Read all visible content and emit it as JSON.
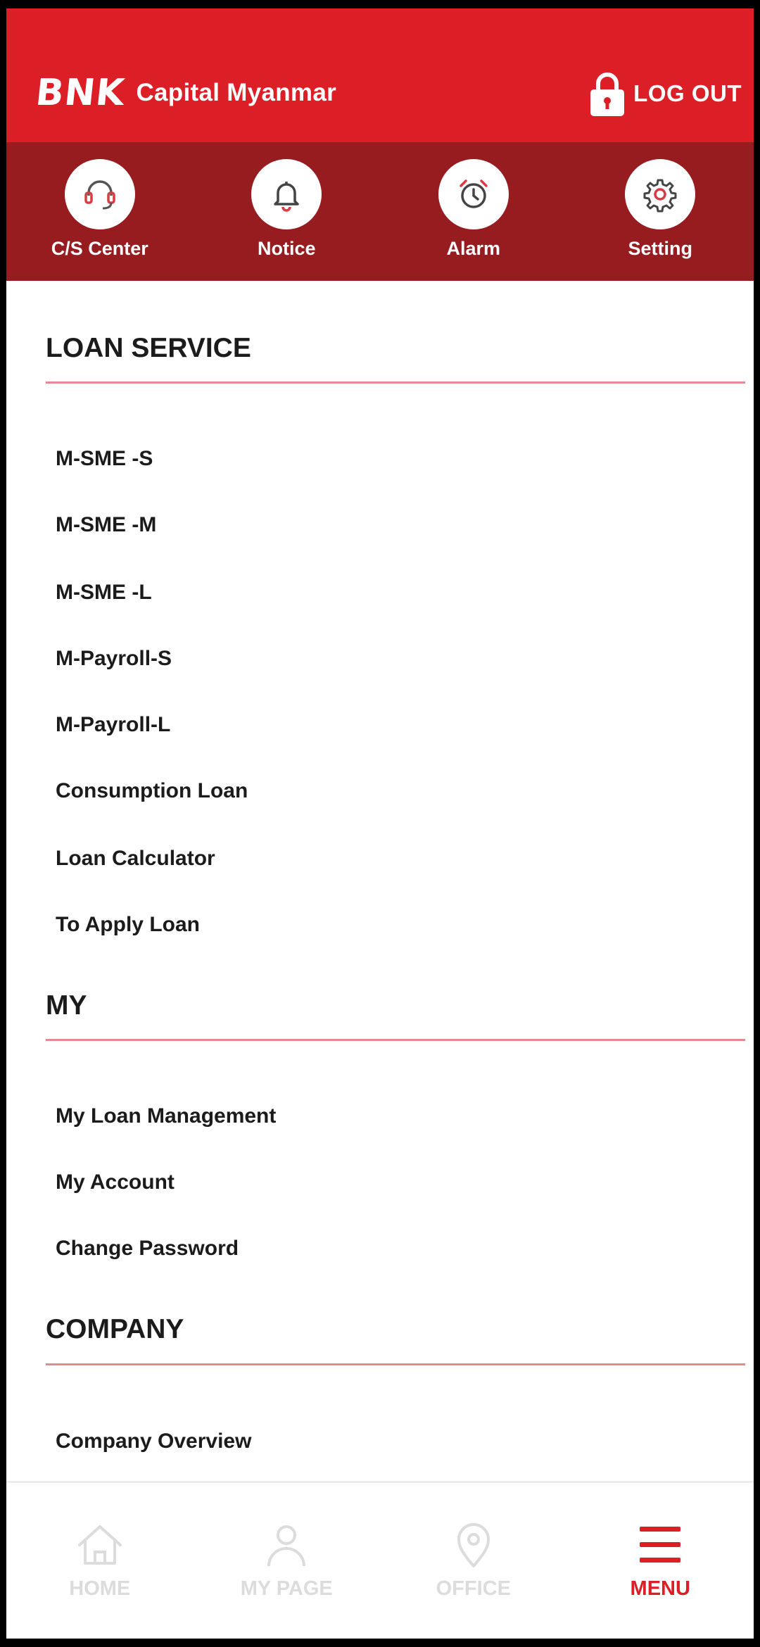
{
  "header": {
    "logo": "BNK",
    "brand_name": "Capital Myanmar",
    "logout_label": "LOG OUT"
  },
  "quick_actions": [
    {
      "label": "C/S Center",
      "icon": "headset-icon"
    },
    {
      "label": "Notice",
      "icon": "bell-icon"
    },
    {
      "label": "Alarm",
      "icon": "alarm-clock-icon"
    },
    {
      "label": "Setting",
      "icon": "gear-icon"
    }
  ],
  "sections": {
    "loan_service": {
      "title": "LOAN SERVICE",
      "items": [
        "M-SME -S",
        "M-SME -M",
        "M-SME -L",
        "M-Payroll-S",
        "M-Payroll-L",
        "Consumption Loan",
        "Loan Calculator",
        "To Apply Loan"
      ]
    },
    "my": {
      "title": "MY",
      "items": [
        "My Loan Management",
        "My Account",
        "Change Password"
      ]
    },
    "company": {
      "title": "COMPANY",
      "items": [
        "Company Overview"
      ]
    }
  },
  "bottom_nav": {
    "items": [
      {
        "label": "HOME",
        "icon": "home-icon",
        "active": false
      },
      {
        "label": "MY PAGE",
        "icon": "person-icon",
        "active": false
      },
      {
        "label": "OFFICE",
        "icon": "location-pin-icon",
        "active": false
      },
      {
        "label": "MENU",
        "icon": "hamburger-menu-icon",
        "active": true
      }
    ]
  },
  "colors": {
    "header_red": "#dc1f26",
    "quickbar_dark_red": "#961c20",
    "divider_pink": "#e58a90",
    "inactive_nav": "#dcdcdc"
  }
}
